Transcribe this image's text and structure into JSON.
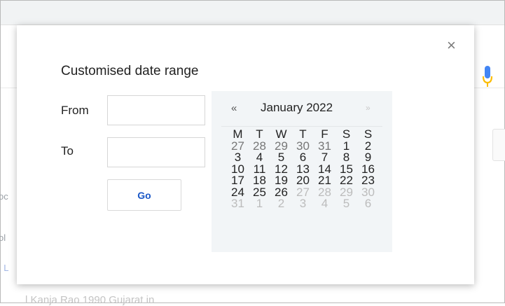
{
  "dialog": {
    "title": "Customised date range",
    "close_glyph": "×",
    "from_label": "From",
    "to_label": "To",
    "from_value": "",
    "to_value": "",
    "go_label": "Go"
  },
  "calendar": {
    "prev_glyph": "«",
    "next_glyph": "»",
    "month_label": "January 2022",
    "weekdays": [
      "M",
      "T",
      "W",
      "T",
      "F",
      "S",
      "S"
    ],
    "days": [
      {
        "n": "27",
        "state": "prev-month"
      },
      {
        "n": "28",
        "state": "prev-month"
      },
      {
        "n": "29",
        "state": "prev-month"
      },
      {
        "n": "30",
        "state": "prev-month"
      },
      {
        "n": "31",
        "state": "prev-month"
      },
      {
        "n": "1",
        "state": "normal"
      },
      {
        "n": "2",
        "state": "normal"
      },
      {
        "n": "3",
        "state": "normal"
      },
      {
        "n": "4",
        "state": "normal"
      },
      {
        "n": "5",
        "state": "normal"
      },
      {
        "n": "6",
        "state": "normal"
      },
      {
        "n": "7",
        "state": "normal"
      },
      {
        "n": "8",
        "state": "normal"
      },
      {
        "n": "9",
        "state": "normal"
      },
      {
        "n": "10",
        "state": "normal"
      },
      {
        "n": "11",
        "state": "normal"
      },
      {
        "n": "12",
        "state": "normal"
      },
      {
        "n": "13",
        "state": "normal"
      },
      {
        "n": "14",
        "state": "normal"
      },
      {
        "n": "15",
        "state": "normal"
      },
      {
        "n": "16",
        "state": "normal"
      },
      {
        "n": "17",
        "state": "normal"
      },
      {
        "n": "18",
        "state": "normal"
      },
      {
        "n": "19",
        "state": "normal"
      },
      {
        "n": "20",
        "state": "normal"
      },
      {
        "n": "21",
        "state": "normal"
      },
      {
        "n": "22",
        "state": "normal"
      },
      {
        "n": "23",
        "state": "normal"
      },
      {
        "n": "24",
        "state": "normal"
      },
      {
        "n": "25",
        "state": "normal"
      },
      {
        "n": "26",
        "state": "normal"
      },
      {
        "n": "27",
        "state": "muted"
      },
      {
        "n": "28",
        "state": "muted"
      },
      {
        "n": "29",
        "state": "muted"
      },
      {
        "n": "30",
        "state": "muted"
      },
      {
        "n": "31",
        "state": "muted"
      },
      {
        "n": "1",
        "state": "muted"
      },
      {
        "n": "2",
        "state": "muted"
      },
      {
        "n": "3",
        "state": "muted"
      },
      {
        "n": "4",
        "state": "muted"
      },
      {
        "n": "5",
        "state": "muted"
      },
      {
        "n": "6",
        "state": "muted"
      }
    ]
  },
  "background": {
    "fragments": [
      "oc",
      "ol",
      ", L"
    ],
    "bottom_text": "l Kanja Rao 1990 Gujarat in"
  },
  "colors": {
    "go_text": "#1a57c7",
    "calendar_bg": "#f2f5f7",
    "mic_blue": "#4285f4",
    "mic_yellow": "#fbbc04"
  },
  "icons": {
    "close": "close-icon",
    "mic": "microphone-icon"
  }
}
